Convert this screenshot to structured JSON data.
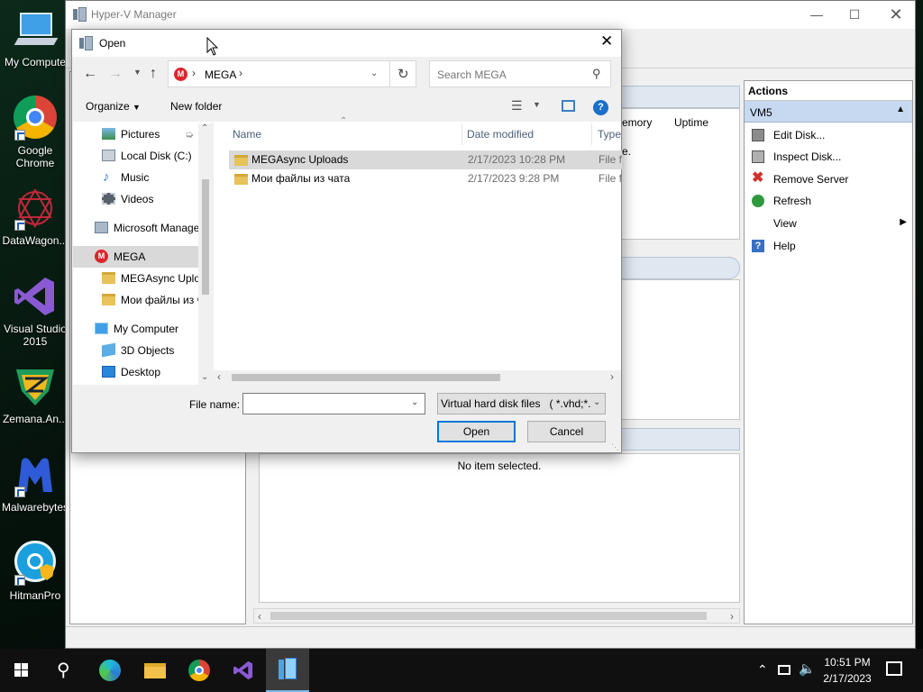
{
  "desktop": {
    "icons": [
      {
        "label": "My Compute"
      },
      {
        "label": "Google Chrome"
      },
      {
        "label": "DataWagon..."
      },
      {
        "label": "Visual Studio 2015"
      },
      {
        "label": "Zemana.An..."
      },
      {
        "label": "Malwarebytes"
      },
      {
        "label": "HitmanPro"
      }
    ]
  },
  "hyperv": {
    "title": "Hyper-V Manager",
    "columns": {
      "memory": "emory",
      "uptime": "Uptime"
    },
    "status_fragment": "e.",
    "no_item": "No item selected.",
    "actions": {
      "header": "Actions",
      "group": "VM5",
      "items": [
        {
          "label": "Edit Disk...",
          "icon": "edit-disk-icon"
        },
        {
          "label": "Inspect Disk...",
          "icon": "inspect-disk-icon"
        },
        {
          "label": "Remove Server",
          "icon": "remove-icon"
        },
        {
          "label": "Refresh",
          "icon": "refresh-icon"
        },
        {
          "label": "View",
          "icon": "none"
        },
        {
          "label": "Help",
          "icon": "help-icon"
        }
      ]
    }
  },
  "dialog": {
    "title": "Open",
    "breadcrumb": {
      "location": "MEGA"
    },
    "search": {
      "placeholder": "Search MEGA"
    },
    "toolbar": {
      "organize": "Organize",
      "new_folder": "New folder"
    },
    "nav": [
      {
        "label": "Pictures",
        "icon": "pictures-icon"
      },
      {
        "label": "Local Disk (C:)",
        "icon": "disk-icon"
      },
      {
        "label": "Music",
        "icon": "music-icon"
      },
      {
        "label": "Videos",
        "icon": "videos-icon"
      },
      {
        "label": "Microsoft Manage",
        "icon": "hyperv-icon"
      },
      {
        "label": "MEGA",
        "icon": "mega-icon"
      },
      {
        "label": "MEGAsync Uplo",
        "icon": "folder-icon"
      },
      {
        "label": "Мои файлы из ч",
        "icon": "folder-icon"
      },
      {
        "label": "My Computer",
        "icon": "computer-icon"
      },
      {
        "label": "3D Objects",
        "icon": "objects-icon"
      },
      {
        "label": "Desktop",
        "icon": "desktop-icon"
      }
    ],
    "columns": {
      "name": "Name",
      "date": "Date modified",
      "type": "Type"
    },
    "files": [
      {
        "name": "MEGAsync Uploads",
        "date": "2/17/2023 10:28 PM",
        "type": "File fo"
      },
      {
        "name": "Мои файлы из чата",
        "date": "2/17/2023 9:28 PM",
        "type": "File fo"
      }
    ],
    "filename": {
      "label": "File name:",
      "value": ""
    },
    "filetype": {
      "selected": "Virtual hard disk files   ( *.vhd;*."
    },
    "buttons": {
      "open": "Open",
      "cancel": "Cancel"
    }
  },
  "taskbar": {
    "clock": {
      "time": "10:51 PM",
      "date": "2/17/2023"
    }
  },
  "colors": {
    "accent": "#0078d7",
    "actions_header": "#c6d9f0",
    "selection": "#cce8ff"
  }
}
